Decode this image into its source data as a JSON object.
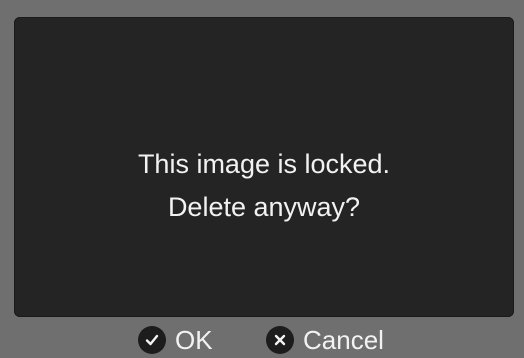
{
  "dialog": {
    "message_line1": "This image is locked.",
    "message_line2": "Delete anyway?"
  },
  "buttons": {
    "ok": {
      "label": "OK",
      "icon": "check-icon"
    },
    "cancel": {
      "label": "Cancel",
      "icon": "x-icon"
    }
  },
  "colors": {
    "frame": "#6f6f6f",
    "dialog_bg": "#242424",
    "text": "#f2f2f2",
    "icon_bg": "#1c1c1c"
  }
}
